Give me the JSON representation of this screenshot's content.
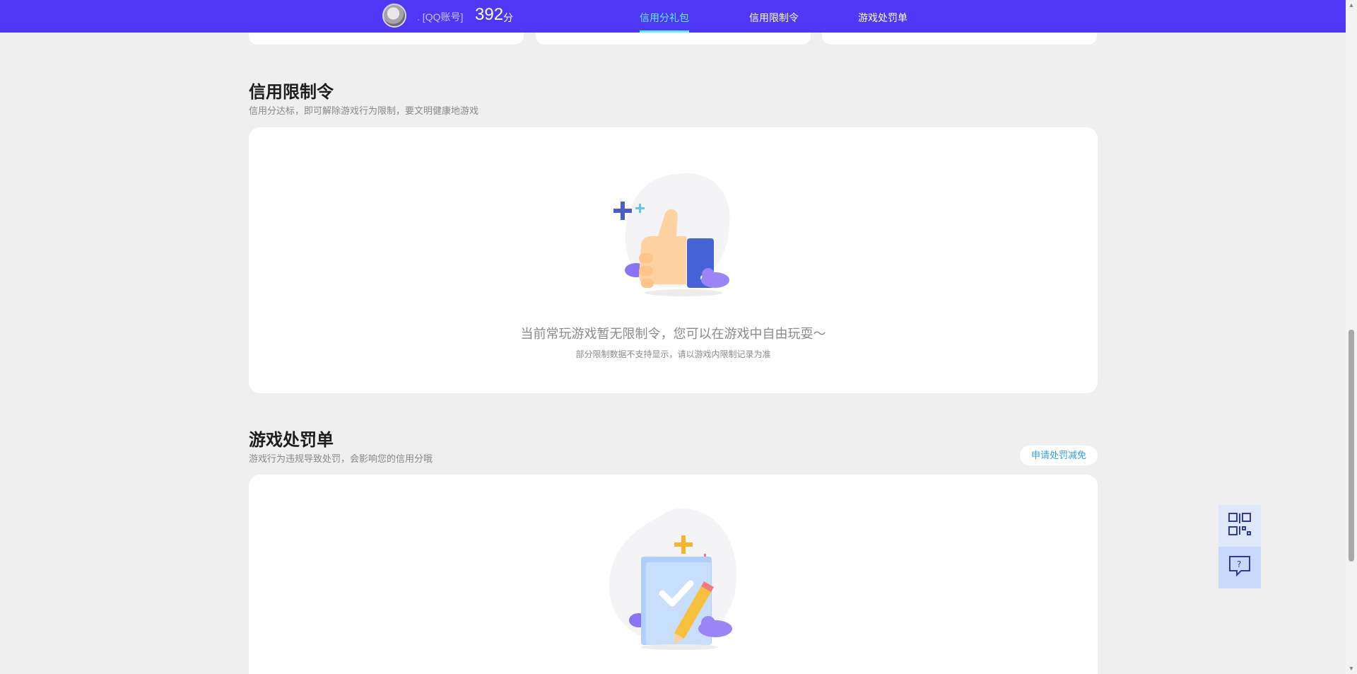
{
  "header": {
    "account_text": ". [QQ账号]",
    "score": "392",
    "score_unit": "分",
    "nav": [
      {
        "label": "信用分礼包",
        "active": true
      },
      {
        "label": "信用限制令",
        "active": false
      },
      {
        "label": "游戏处罚单",
        "active": false
      }
    ]
  },
  "restriction": {
    "title": "信用限制令",
    "subtitle": "信用分达标，即可解除游戏行为限制，要文明健康地游戏",
    "empty_main": "当前常玩游戏暂无限制令，您可以在游戏中自由玩耍～",
    "empty_sub": "部分限制数据不支持显示，请以游戏内限制记录为准",
    "illustration_icon": "thumbs-up-icon"
  },
  "penalty": {
    "title": "游戏处罚单",
    "subtitle": "游戏行为违规导致处罚，会影响您的信用分哦",
    "appeal_button": "申请处罚减免",
    "illustration_icon": "clipboard-check-icon"
  },
  "floating": {
    "items": [
      {
        "icon": "qr-code-icon"
      },
      {
        "icon": "help-chat-icon"
      }
    ]
  },
  "colors": {
    "header_bg": "#4e37f5",
    "nav_active": "#5ff0ff",
    "page_bg": "#efefef",
    "link_blue": "#2f9ff0"
  }
}
